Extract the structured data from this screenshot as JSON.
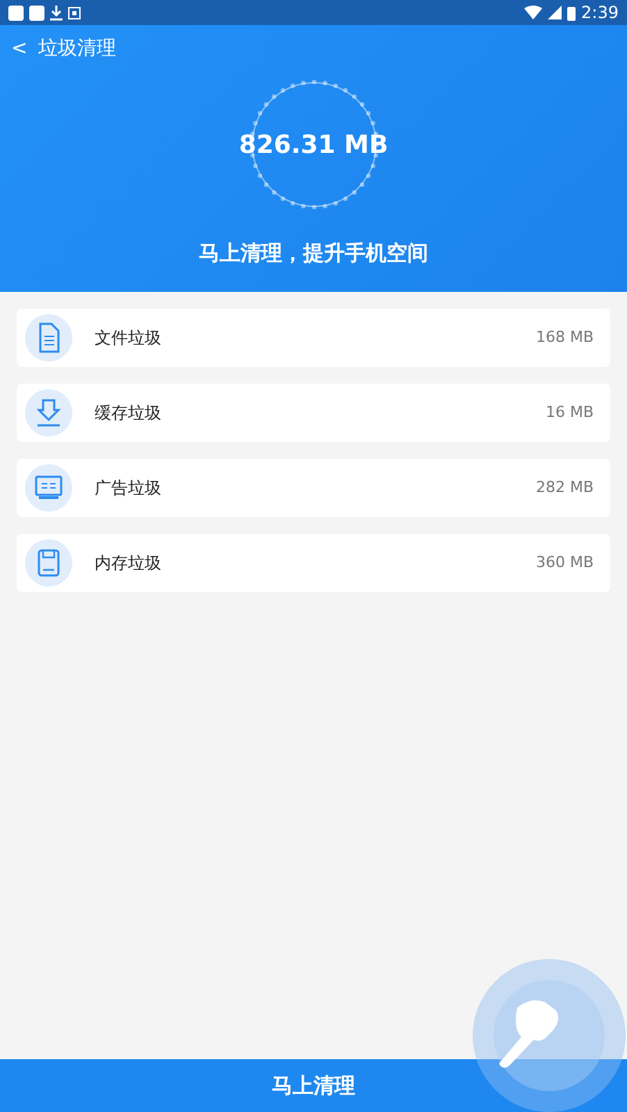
{
  "status_bar": {
    "time": "2:39"
  },
  "header": {
    "back": "<",
    "title": "垃圾清理",
    "total": "826.31 MB",
    "subtitle": "马上清理，提升手机空间"
  },
  "items": [
    {
      "kind": "file",
      "label": "文件垃圾",
      "size": "168 MB"
    },
    {
      "kind": "cache",
      "label": "缓存垃圾",
      "size": "16 MB"
    },
    {
      "kind": "ad",
      "label": "广告垃圾",
      "size": "282 MB"
    },
    {
      "kind": "memory",
      "label": "内存垃圾",
      "size": "360 MB"
    }
  ],
  "clean_button": "马上清理"
}
